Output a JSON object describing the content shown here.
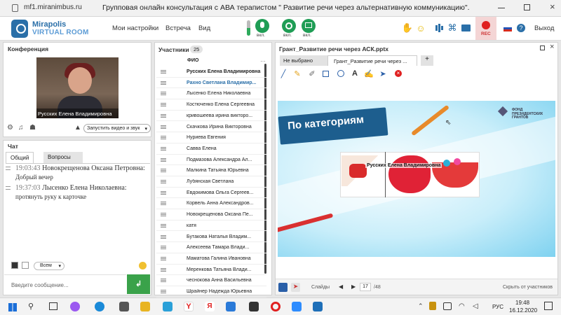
{
  "browser": {
    "url": "mf1.miranimbus.ru",
    "title": "Групповая онлайн консультация с АВА терапистом \" Развитие речи через альтернативную коммуникацию\"."
  },
  "header": {
    "logo_line1": "Mirapolis",
    "logo_line2": "VIRTUAL ROOM",
    "menu": [
      "Мои настройки",
      "Встреча",
      "Вид"
    ],
    "mic_label": "вкл.",
    "cam_label": "вкл.",
    "screen_label": "вкл.",
    "rec_label": "REC",
    "exit_label": "Выход"
  },
  "conference": {
    "title": "Конференция",
    "video_name": "Русских Елена Владимировна",
    "start_video_label": "Запустить видео и звук"
  },
  "chat": {
    "title": "Чат",
    "tabs": [
      "Общий",
      "Вопросы"
    ],
    "messages": [
      {
        "time": "19:03:43",
        "author": "Новокрещенова  Оксана Петровна:",
        "text": "Добрый вечер"
      },
      {
        "time": "19:37:03",
        "author": "Лысенко Елена  Николаевна:",
        "text": "протянуть руку к карточке"
      }
    ],
    "recipient": "Всем",
    "input_placeholder": "Введите сообщение..."
  },
  "participants": {
    "title": "Участники",
    "count": "25",
    "column": "ФИО",
    "list": [
      "Русских Елена Владимировна",
      "Рахно Светлана  Владимир...",
      "Лысенко Елена  Николаевна",
      "Костюченко  Елена Сергеевна",
      "кривошеева  ирина викторо...",
      "Скачкова  Ирина Викторовна",
      "Нуриева Евгения",
      "Савва  Елена",
      "Подмазова  Александра Ал...",
      "Малкина Татьяна  Юрьевна",
      "Лубянская  Светлана",
      "Евдокимова Ольга  Сергеев...",
      "Корвель Анна  Александров...",
      "Новокрещенова  Оксана Пе...",
      "катя",
      "Бутакова  Наталья Владим...",
      "Алексеева  Тамара  Влади...",
      "Маматова  Галина Ивановна",
      "Меренкова  Татьяна  Влади...",
      "чеснокова  Анна  Васильевна",
      "Шрайнер Надежда Юрьевна"
    ]
  },
  "presentation": {
    "title": "Грант_Развитие речи через АСК.pptx",
    "tabs": [
      "Не выбрано",
      "Грант_Развитие речи через ..."
    ],
    "add_tab": "+",
    "slide_heading": "По категориям",
    "fund_text": "ФОНД\nПРЕЗИДЕНТСКИХ\nГРАНТОВ",
    "overlay_name": "Русских Елена Владимировна",
    "slides_label": "Слайды",
    "current_slide": "17",
    "total_slides": "/48",
    "hide_label": "Скрыть от участников"
  },
  "taskbar": {
    "language": "РУС",
    "time": "19:48",
    "date": "16.12.2020"
  }
}
